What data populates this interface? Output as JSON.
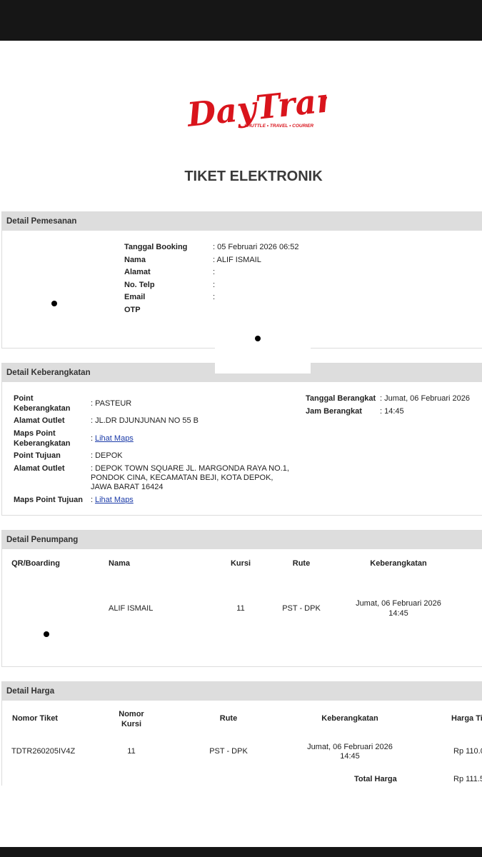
{
  "logo": {
    "brand": "DayTrans",
    "tagline": "SHUTTLE • TRAVEL • COURIER",
    "color": "#d9141c"
  },
  "title": "TIKET ELEKTRONIK",
  "booking": {
    "header": "Detail Pemesanan",
    "rows": [
      {
        "label": "Tanggal Booking",
        "value": ": 05 Februari 2026 06:52"
      },
      {
        "label": "Nama",
        "value": ": ALIF ISMAIL"
      },
      {
        "label": "Alamat",
        "value": ":"
      },
      {
        "label": "No. Telp",
        "value": ":"
      },
      {
        "label": "Email",
        "value": ":"
      },
      {
        "label": "OTP",
        "value": ""
      }
    ]
  },
  "departure": {
    "header": "Detail Keberangkatan",
    "point_label": "Point Keberangkatan",
    "point_value": ": PASTEUR",
    "outlet_label": "Alamat Outlet",
    "outlet_value": ": JL.DR DJUNJUNAN NO 55 B",
    "maps_label": "Maps Point Keberangkatan",
    "maps_link": "Lihat Maps",
    "dest_label": "Point Tujuan",
    "dest_value": ": DEPOK",
    "dest_outlet_label": "Alamat Outlet",
    "dest_outlet_lines": [
      ": DEPOK TOWN SQUARE JL. MARGONDA RAYA NO.1,",
      "PONDOK CINA, KECAMATAN BEJI, KOTA DEPOK,",
      "JAWA BARAT 16424"
    ],
    "dest_maps_label": "Maps Point Tujuan",
    "dest_maps_link": "Lihat Maps",
    "date_label": "Tanggal Berangkat",
    "date_value": ": Jumat, 06 Februari 2026",
    "time_label": "Jam Berangkat",
    "time_value": ": 14:45"
  },
  "passenger": {
    "header": "Detail Penumpang",
    "columns": [
      "QR/Boarding",
      "Nama",
      "Kursi",
      "Rute",
      "Keberangkatan"
    ],
    "row": {
      "name": "ALIF ISMAIL",
      "seat": "11",
      "route": "PST - DPK",
      "dep_line1": "Jumat, 06 Februari 2026",
      "dep_line2": "14:45"
    }
  },
  "price": {
    "header": "Detail Harga",
    "columns": [
      "Nomor Tiket",
      "Nomor Kursi",
      "Rute",
      "Keberangkatan",
      "Harga Ti"
    ],
    "row": {
      "ticket": "TDTR260205IV4Z",
      "seat": "11",
      "route": "PST - DPK",
      "dep_line1": "Jumat, 06 Februari 2026",
      "dep_line2": "14:45",
      "price": "Rp 110.0"
    },
    "total_label": "Total Harga",
    "total_value": "Rp 111.5"
  }
}
